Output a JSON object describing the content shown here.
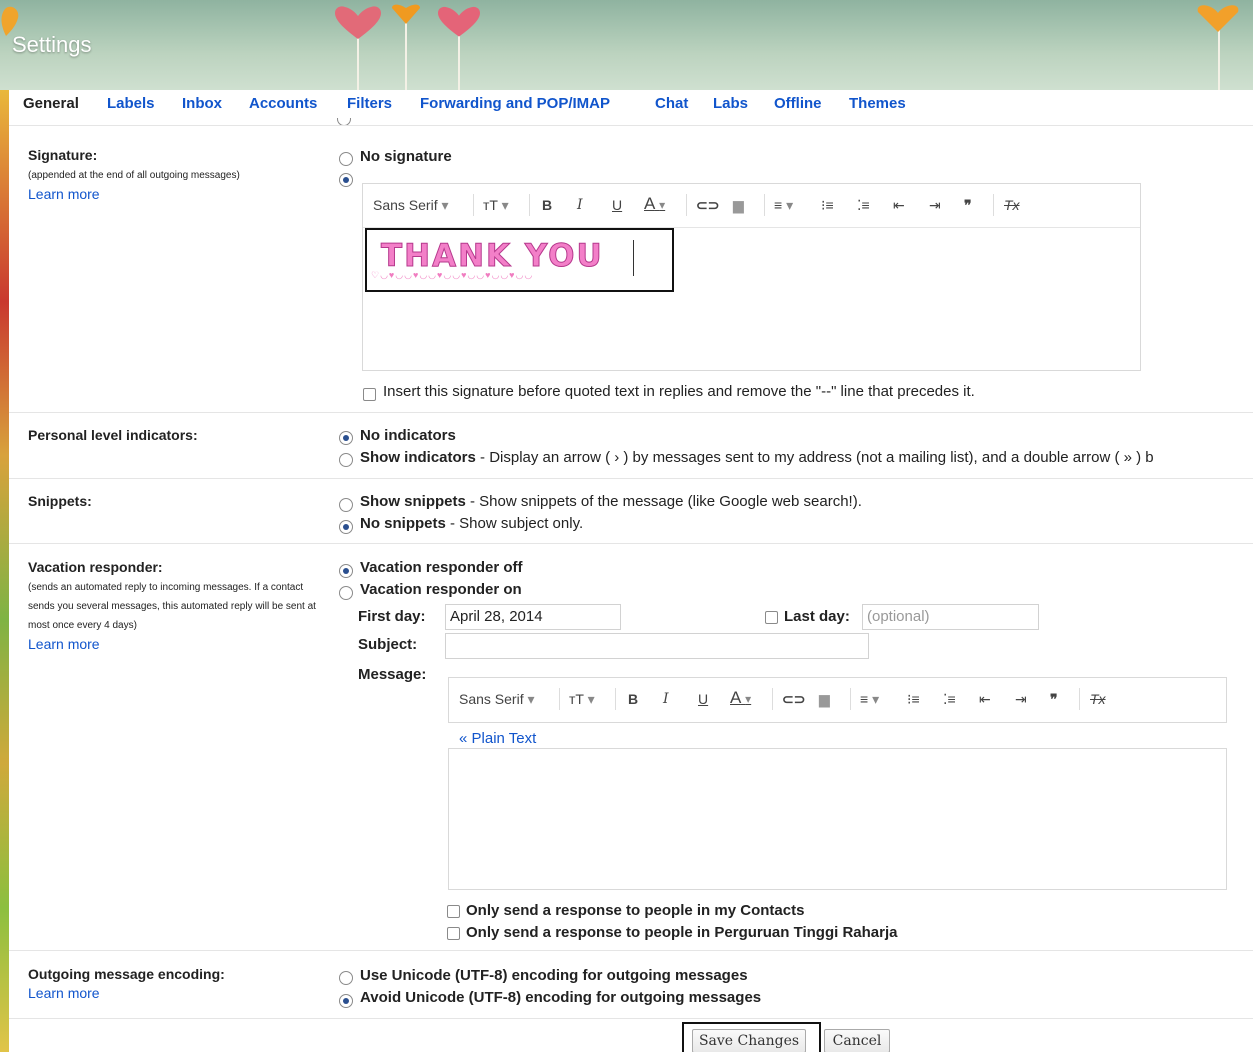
{
  "header": {
    "title": "Settings"
  },
  "tabs": [
    {
      "label": "General",
      "active": true
    },
    {
      "label": "Labels"
    },
    {
      "label": "Inbox"
    },
    {
      "label": "Accounts"
    },
    {
      "label": "Filters"
    },
    {
      "label": "Forwarding and POP/IMAP"
    },
    {
      "label": "Chat"
    },
    {
      "label": "Labs"
    },
    {
      "label": "Offline"
    },
    {
      "label": "Themes"
    }
  ],
  "signature": {
    "label": "Signature:",
    "sub": "(appended at the end of all outgoing messages)",
    "learn_more": "Learn more",
    "no_signature": "No signature",
    "image_text": "THANK YOU",
    "image_deco": "♡◡♥◡◡♥◡◡♥◡◡♥◡◡♥◡◡♥◡◡",
    "insert_before": "Insert this signature before quoted text in replies and remove the \"--\" line that precedes it."
  },
  "toolbar": {
    "font": "Sans Serif",
    "font_arrow": "▾",
    "size": "ᴛT",
    "bold": "B",
    "italic": "I",
    "underline": "U",
    "text_color": "A",
    "link": "⊂⊃",
    "image": "▆",
    "align": "≡",
    "numbered": "⁝≡",
    "bulleted": "⁚≡",
    "indent_less": "⇤",
    "indent_more": "⇥",
    "quote": "❞",
    "clear": "Tx"
  },
  "personal_level": {
    "label": "Personal level indicators:",
    "no_indicators": "No indicators",
    "show_indicators_bold": "Show indicators",
    "show_indicators_desc": " - Display an arrow ( › ) by messages sent to my address (not a mailing list), and a double arrow ( » ) b"
  },
  "snippets": {
    "label": "Snippets:",
    "show_bold": "Show snippets",
    "show_desc": " - Show snippets of the message (like Google web search!).",
    "no_bold": "No snippets",
    "no_desc": " - Show subject only."
  },
  "vacation": {
    "label": "Vacation responder:",
    "sub": "(sends an automated reply to incoming messages. If a contact sends you several messages, this automated reply will be sent at most once every 4 days)",
    "learn_more": "Learn more",
    "off": "Vacation responder off",
    "on": "Vacation responder on",
    "first_day_label": "First day:",
    "first_day_value": "April 28, 2014",
    "last_day_label": "Last day:",
    "last_day_placeholder": "(optional)",
    "subject_label": "Subject:",
    "message_label": "Message:",
    "plain_text": "« Plain Text",
    "only_contacts": "Only send a response to people in my Contacts",
    "only_org": "Only send a response to people in Perguruan Tinggi Raharja"
  },
  "encoding": {
    "label": "Outgoing message encoding:",
    "learn_more": "Learn more",
    "use_unicode": "Use Unicode (UTF-8) encoding for outgoing messages",
    "avoid_unicode": "Avoid Unicode (UTF-8) encoding for outgoing messages"
  },
  "actions": {
    "save": "Save Changes",
    "cancel": "Cancel"
  }
}
